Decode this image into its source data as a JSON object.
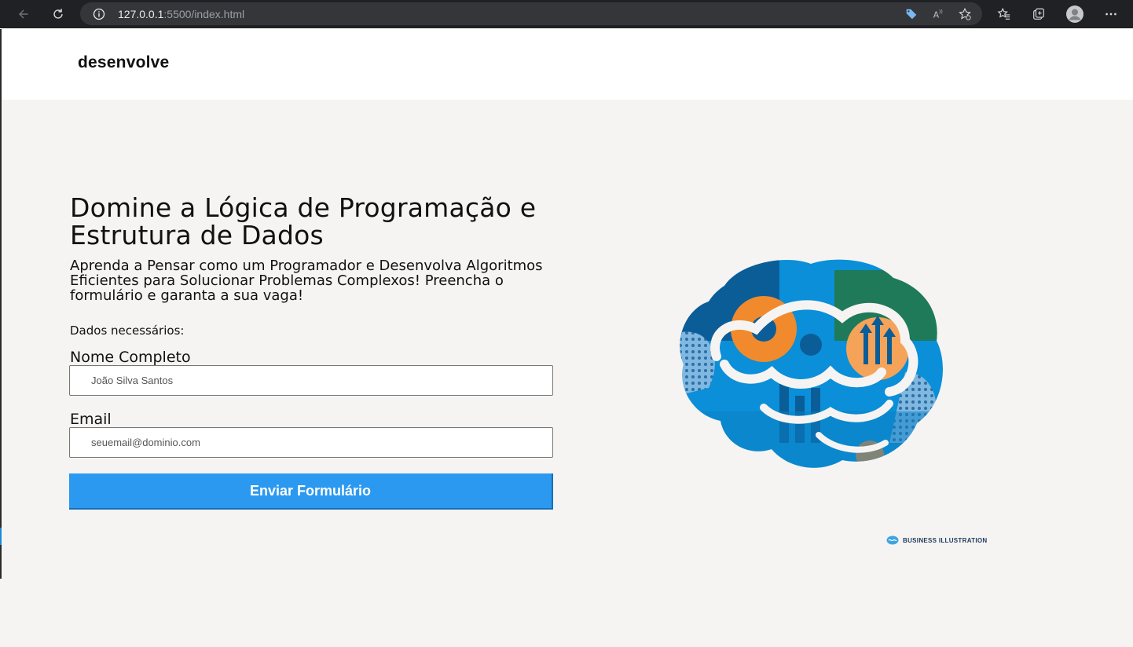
{
  "browser": {
    "url_host": "127.0.0.1",
    "url_path": ":5500/index.html"
  },
  "header": {
    "logo": "desenvolve"
  },
  "hero": {
    "title": "Domine a Lógica de Programação e Estrutura de Dados",
    "subtitle": "Aprenda a Pensar como um Programador e Desenvolva Algoritmos Eficientes para Solucionar Problemas Complexos! Preencha o formulário e garanta a sua vaga!"
  },
  "form": {
    "section_label": "Dados necessários:",
    "name_label": "Nome Completo",
    "name_placeholder": "João Silva Santos",
    "email_label": "Email",
    "email_placeholder": "seuemail@dominio.com",
    "submit_label": "Enviar Formulário"
  },
  "illustration": {
    "icon": "brain-illustration",
    "credit": "BUSINESS ILLUSTRATION"
  },
  "colors": {
    "accent": "#2b99f0",
    "page_bg": "#f5f4f3",
    "brain_blue": "#0a8fd8",
    "brain_orange": "#f18a2c",
    "brain_green": "#1f7a5a"
  }
}
